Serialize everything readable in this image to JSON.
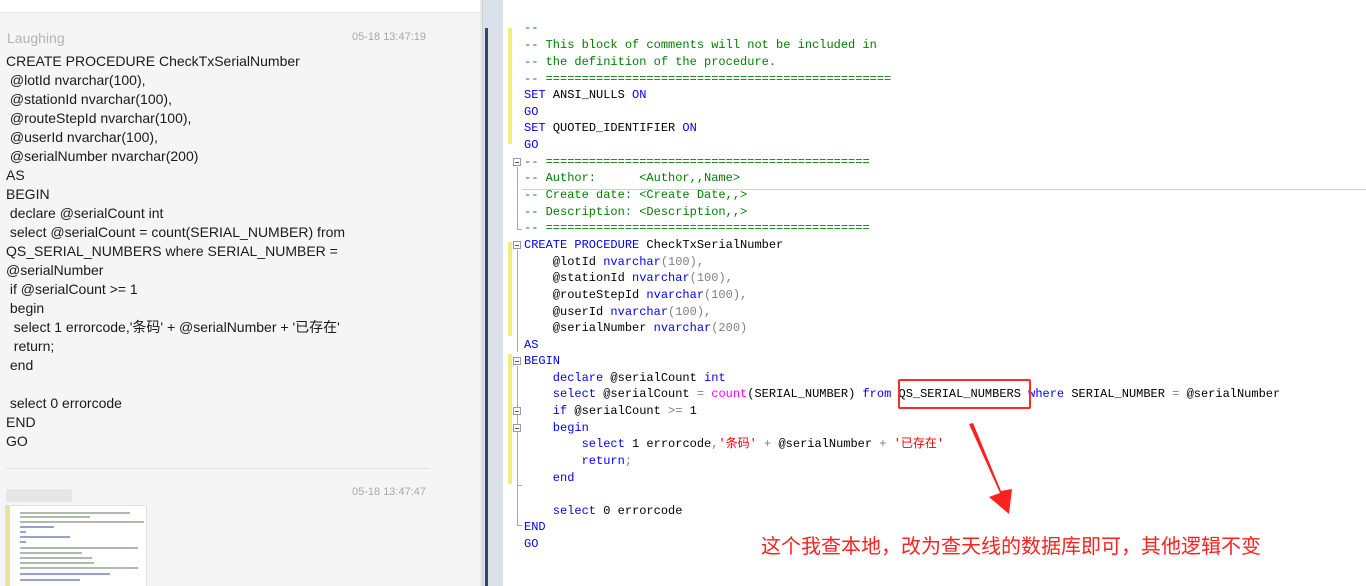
{
  "chat": {
    "message1": {
      "sender": "Laughing",
      "time": "05-18 13:47:19",
      "lines": [
        "CREATE PROCEDURE CheckTxSerialNumber",
        " @lotId nvarchar(100),",
        " @stationId nvarchar(100),",
        " @routeStepId nvarchar(100),",
        " @userId nvarchar(100),",
        " @serialNumber nvarchar(200)",
        "AS",
        "BEGIN",
        " declare @serialCount int",
        " select @serialCount = count(SERIAL_NUMBER) from",
        "QS_SERIAL_NUMBERS where SERIAL_NUMBER =",
        "@serialNumber",
        " if @serialCount >= 1",
        " begin",
        "  select 1 errorcode,'条码' + @serialNumber + '已存在'",
        "  return;",
        " end",
        "",
        " select 0 errorcode",
        "END",
        "GO"
      ]
    },
    "message2": {
      "time": "05-18 13:47:47"
    }
  },
  "editor": {
    "lines": {
      "l0": "--",
      "l1": "-- This block of comments will not be included in",
      "l2": "-- the definition of the procedure.",
      "l3": "-- ================================================",
      "l4a": "SET ",
      "l4b": "ANSI_NULLS",
      "l4c": " ON",
      "l5": "GO",
      "l6a": "SET ",
      "l6b": "QUOTED_IDENTIFIER",
      "l6c": " ON",
      "l7": "GO",
      "l8": "-- =============================================",
      "l9": "-- Author:      <Author,,Name>",
      "l10": "-- Create date: <Create Date,,>",
      "l11": "-- Description: <Description,,>",
      "l12": "-- =============================================",
      "l13a": "CREATE PROCEDURE",
      "l13b": " CheckTxSerialNumber",
      "l14a": "    @lotId ",
      "l14b": "nvarchar",
      "l14c": "(100),",
      "l15a": "    @stationId ",
      "l15b": "nvarchar",
      "l15c": "(100),",
      "l16a": "    @routeStepId ",
      "l16b": "nvarchar",
      "l16c": "(100),",
      "l17a": "    @userId ",
      "l17b": "nvarchar",
      "l17c": "(100),",
      "l18a": "    @serialNumber ",
      "l18b": "nvarchar",
      "l18c": "(200)",
      "l19": "AS",
      "l20": "BEGIN",
      "l21a": "    declare",
      "l21b": " @serialCount ",
      "l21c": "int",
      "l22a": "    select",
      "l22b": " @serialCount ",
      "l22c": "=",
      "l22d": " ",
      "l22e": "count",
      "l22f": "(SERIAL_NUMBER) ",
      "l22g": "from",
      "l22h": " QS_SERIAL_NUMBERS ",
      "l22i": "where",
      "l22j": " SERIAL_NUMBER ",
      "l22k": "=",
      "l22l": " @serialNumber",
      "l23a": "    if",
      "l23b": " @serialCount ",
      "l23c": ">=",
      "l23d": " 1",
      "l24": "    begin",
      "l25a": "        select",
      "l25b": " 1 errorcode",
      "l25c": ",",
      "l25d": "'条码'",
      "l25e": " + ",
      "l25f": "@serialNumber",
      "l25g": " + ",
      "l25h": "'已存在'",
      "l26a": "        return",
      "l26b": ";",
      "l27": "    end",
      "l28": "",
      "l29a": "    select",
      "l29b": " 0 errorcode",
      "l30": "END",
      "l31": "GO"
    },
    "annotation": "这个我查本地，改为查天线的数据库即可，其他逻辑不变"
  },
  "colors": {
    "comment": "#008000",
    "keyword": "#0000ff",
    "string": "#ff0000",
    "function": "#ff00ff",
    "annotation": "#ff2020",
    "change_bar": "#f4ec7c"
  }
}
